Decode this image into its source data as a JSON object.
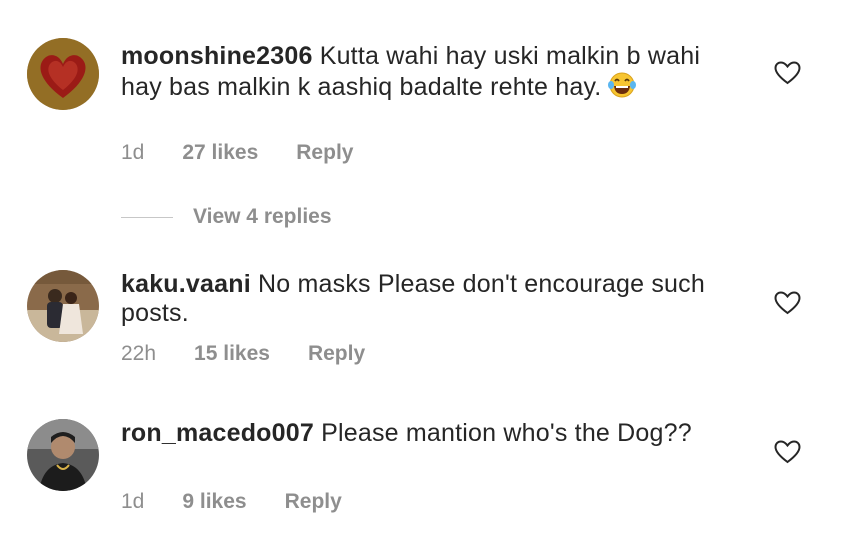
{
  "comments": [
    {
      "username": "moonshine2306",
      "text": " Kutta wahi hay uski malkin b wahi hay bas malkin k aashiq badalte rehte hay.",
      "emoji": "😂",
      "time": "1d",
      "likes": "27 likes",
      "reply": "Reply",
      "avatar": "heart-avatar-icon"
    },
    {
      "username": "kaku.vaani",
      "text": " No masks  Please don't encourage such posts.",
      "time": "22h",
      "likes": "15 likes",
      "reply": "Reply",
      "avatar": "couple-photo-avatar"
    },
    {
      "username": "ron_macedo007",
      "text": " Please mantion who's the Dog??",
      "time": "1d",
      "likes": "9 likes",
      "reply": "Reply",
      "avatar": "man-photo-avatar"
    }
  ],
  "view_replies": "View 4 replies",
  "colors": {
    "text": "#262626",
    "meta": "#8e8e8e",
    "divider": "#c7c7c7"
  }
}
